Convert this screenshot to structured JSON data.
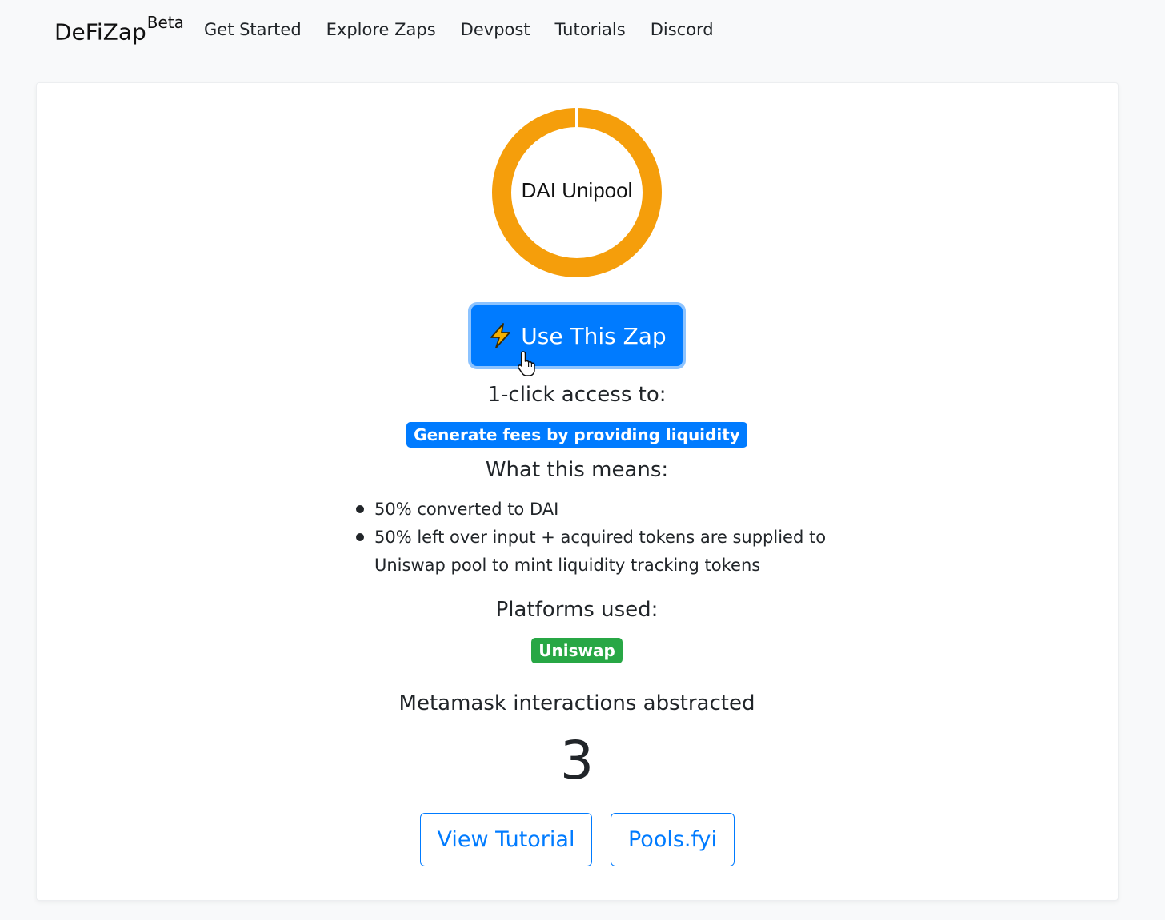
{
  "navbar": {
    "brand": "DeFiZap",
    "brand_sup": "Beta",
    "links": [
      "Get Started",
      "Explore Zaps",
      "Devpost",
      "Tutorials",
      "Discord"
    ]
  },
  "zap": {
    "donut_label": "DAI Unipool",
    "donut_color": "#f59e0b",
    "use_button_label": "Use This Zap",
    "access_heading": "1-click access to:",
    "access_badge": "Generate fees by providing liquidity",
    "means_heading": "What this means:",
    "means_items": [
      "50% converted to DAI",
      "50% left over input + acquired tokens are supplied to Uniswap pool to mint liquidity tracking tokens"
    ],
    "platforms_heading": "Platforms used:",
    "platforms": [
      "Uniswap"
    ],
    "interactions_heading": "Metamask interactions abstracted",
    "interactions_count": "3",
    "buttons": {
      "tutorial": "View Tutorial",
      "pools": "Pools.fyi"
    }
  },
  "colors": {
    "primary": "#007bff",
    "success": "#28a745",
    "donut": "#f59e0b"
  }
}
